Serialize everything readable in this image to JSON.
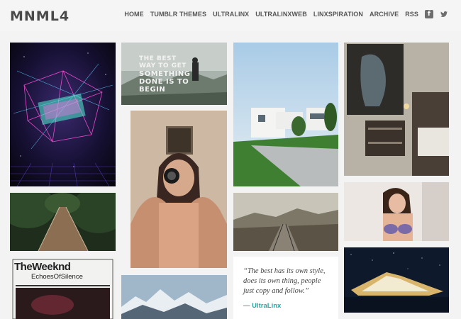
{
  "site": {
    "logo": "MNML4"
  },
  "nav": {
    "items": [
      {
        "label": "HOME"
      },
      {
        "label": "TUMBLR THEMES"
      },
      {
        "label": "ULTRALINX"
      },
      {
        "label": "ULTRALINXWEB"
      },
      {
        "label": "LINXSPIRATION"
      },
      {
        "label": "ARCHIVE"
      },
      {
        "label": "RSS"
      }
    ],
    "facebook_icon": "facebook-icon",
    "twitter_icon": "twitter-icon"
  },
  "posts": {
    "motivation_overlay": {
      "line1": "THE BEST",
      "line2": "WAY TO GET",
      "line3": "SOMETHING",
      "line4": "DONE IS TO",
      "line5": "BEGIN"
    },
    "album": {
      "title": "TheWeeknd",
      "subtitle": "EchoesOfSilence"
    },
    "quote": {
      "text": "“The best has its own style, does its own thing, people just copy and follow.”",
      "author": "— UltraLinx"
    }
  },
  "colors": {
    "accent": "#2aa6a0",
    "text": "#4a4a4a",
    "background": "#f3f3f3"
  }
}
